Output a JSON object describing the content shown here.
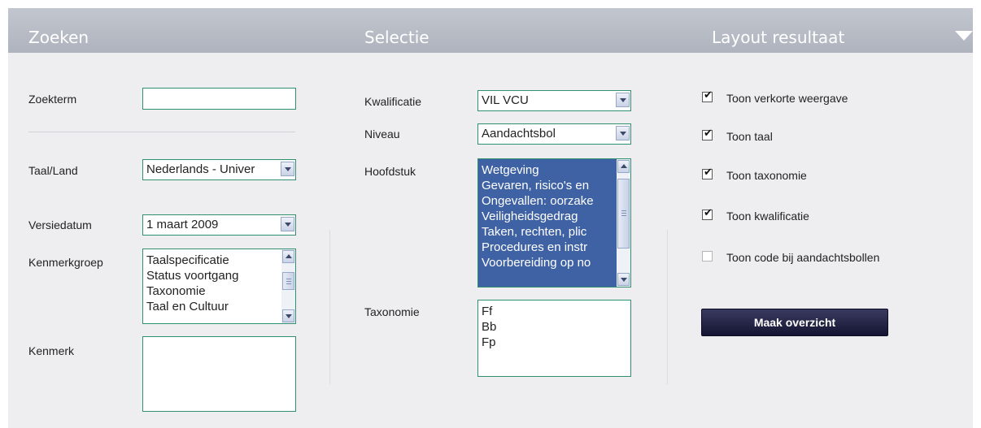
{
  "header": {
    "zoeken": "Zoeken",
    "selectie": "Selectie",
    "layout": "Layout resultaat"
  },
  "zoeken": {
    "zoekterm_label": "Zoekterm",
    "zoekterm_value": "",
    "taal_label": "Taal/Land",
    "taal_value": "Nederlands - Univer",
    "versiedatum_label": "Versiedatum",
    "versiedatum_value": "1 maart 2009",
    "kenmerkgroep_label": "Kenmerkgroep",
    "kenmerkgroep_items": [
      "Taalspecificatie",
      "Status voortgang",
      "Taxonomie",
      "Taal en Cultuur"
    ],
    "kenmerk_label": "Kenmerk"
  },
  "selectie": {
    "kwalificatie_label": "Kwalificatie",
    "kwalificatie_value": "VIL VCU",
    "niveau_label": "Niveau",
    "niveau_value": "Aandachtsbol",
    "hoofdstuk_label": "Hoofdstuk",
    "hoofdstuk_items": [
      "Wetgeving",
      "Gevaren, risico's en",
      "Ongevallen: oorzake",
      "Veiligheidsgedrag",
      "Taken, rechten, plic",
      "Procedures en instr",
      "Voorbereiding op no"
    ],
    "taxonomie_label": "Taxonomie",
    "taxonomie_items": [
      "Ff",
      "Bb",
      "Fp"
    ]
  },
  "layout": {
    "options": [
      {
        "label": "Toon verkorte weergave",
        "checked": true
      },
      {
        "label": "Toon taal",
        "checked": true
      },
      {
        "label": "Toon taxonomie",
        "checked": true
      },
      {
        "label": "Toon kwalificatie",
        "checked": true
      },
      {
        "label": "Toon code bij aandachtsbollen",
        "checked": false
      }
    ],
    "button_label": "Maak overzicht",
    "check_mark": "✔"
  },
  "colors": {
    "header": "#b7bbc4",
    "panel": "#eeeef0",
    "field_border": "#2f8f6f",
    "selection": "#3f62a5",
    "button": "#1e1e40"
  }
}
